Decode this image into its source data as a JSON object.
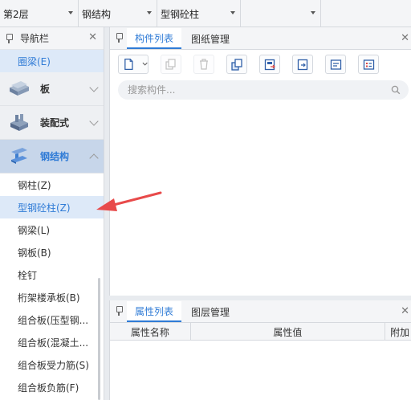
{
  "topbar": {
    "floor": "第2层",
    "category": "钢结构",
    "component_type": "型钢砼柱",
    "extra": ""
  },
  "nav": {
    "title": "导航栏",
    "selected_item": "圈梁(E)",
    "categories": [
      {
        "label": "板"
      },
      {
        "label": "装配式"
      },
      {
        "label": "钢结构"
      }
    ],
    "sub_items": [
      "钢柱(Z)",
      "型钢砼柱(Z)",
      "钢梁(L)",
      "钢板(B)",
      "栓钉",
      "桁架楼承板(B)",
      "组合板(压型钢...",
      "组合板(混凝土...",
      "组合板受力筋(S)",
      "组合板负筋(F)"
    ]
  },
  "component_panel": {
    "tabs": [
      "构件列表",
      "图纸管理"
    ],
    "search_placeholder": "搜索构件..."
  },
  "property_panel": {
    "tabs": [
      "属性列表",
      "图层管理"
    ],
    "columns": [
      "属性名称",
      "属性值",
      "附加"
    ]
  },
  "colors": {
    "accent": "#2f7bd6",
    "selected_bg": "#dde9f8",
    "arrow": "#e84a4a"
  }
}
